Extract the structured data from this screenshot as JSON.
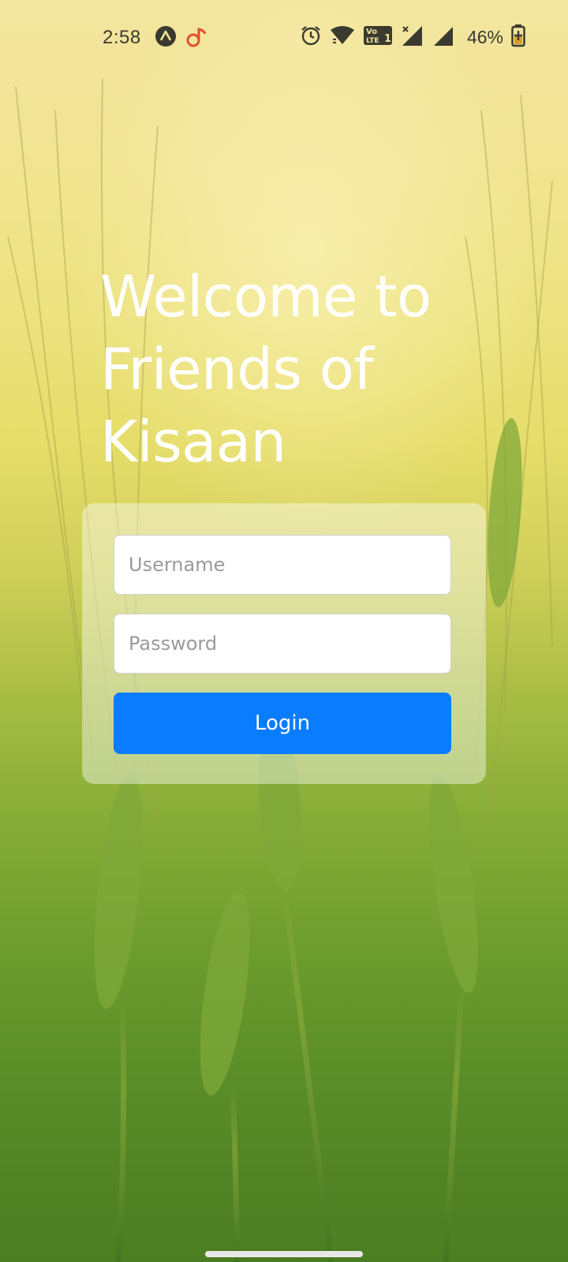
{
  "status_bar": {
    "time": "2:58",
    "battery_percent": "46%",
    "left_icons": [
      "app-a-icon",
      "music-note-icon"
    ],
    "right_icons": [
      "alarm-icon",
      "wifi-icon",
      "volte-lte-icon",
      "signal-sim1-icon",
      "signal-sim2-icon",
      "battery-charging-icon"
    ],
    "volte_line1": "Vo",
    "volte_line2": "LTE",
    "sim_number": "1"
  },
  "welcome": {
    "title": "Welcome to\nFriends of\nKisaan"
  },
  "login_form": {
    "username": {
      "value": "",
      "placeholder": "Username"
    },
    "password": {
      "value": "",
      "placeholder": "Password"
    },
    "submit_label": "Login"
  },
  "colors": {
    "primary_button": "#0a7cff",
    "title_text": "#ffffff",
    "background_top": "#f2e59e",
    "background_bottom": "#4b7d22"
  }
}
